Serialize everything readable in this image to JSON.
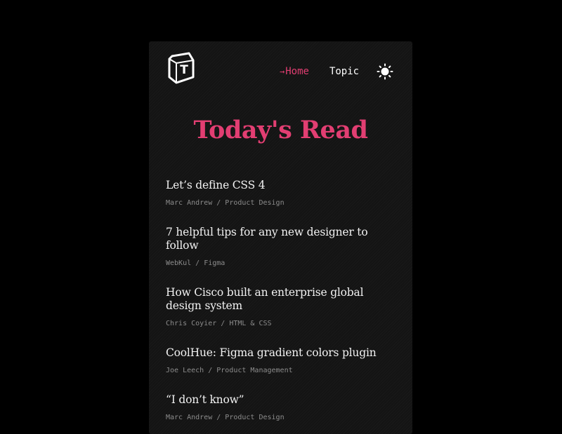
{
  "header": {
    "logo_icon": "t-hexagon-logo",
    "nav": {
      "home_label": "Home",
      "home_arrow": "→",
      "topic_label": "Topic",
      "theme_icon": "sun-icon"
    }
  },
  "main": {
    "title": "Today's Read",
    "articles": [
      {
        "title": "Let’s define CSS 4",
        "author": "Marc Andrew",
        "category": "Product Design"
      },
      {
        "title": "7 helpful tips for any new designer to follow",
        "author": "WebKul",
        "category": "Figma"
      },
      {
        "title": "How Cisco built an enterprise global design system",
        "author": "Chris Coyier",
        "category": "HTML & CSS"
      },
      {
        "title": "CoolHue: Figma gradient colors plugin",
        "author": "Joe Leech",
        "category": "Product Management"
      },
      {
        "title": "“I don’t know”",
        "author": "Marc Andrew",
        "category": "Product Design"
      }
    ],
    "meta_separator": " / "
  },
  "colors": {
    "background": "#000000",
    "card": "#141414",
    "accent": "#e23e72",
    "text": "#f2f2f2",
    "meta": "#8c8c8c"
  }
}
